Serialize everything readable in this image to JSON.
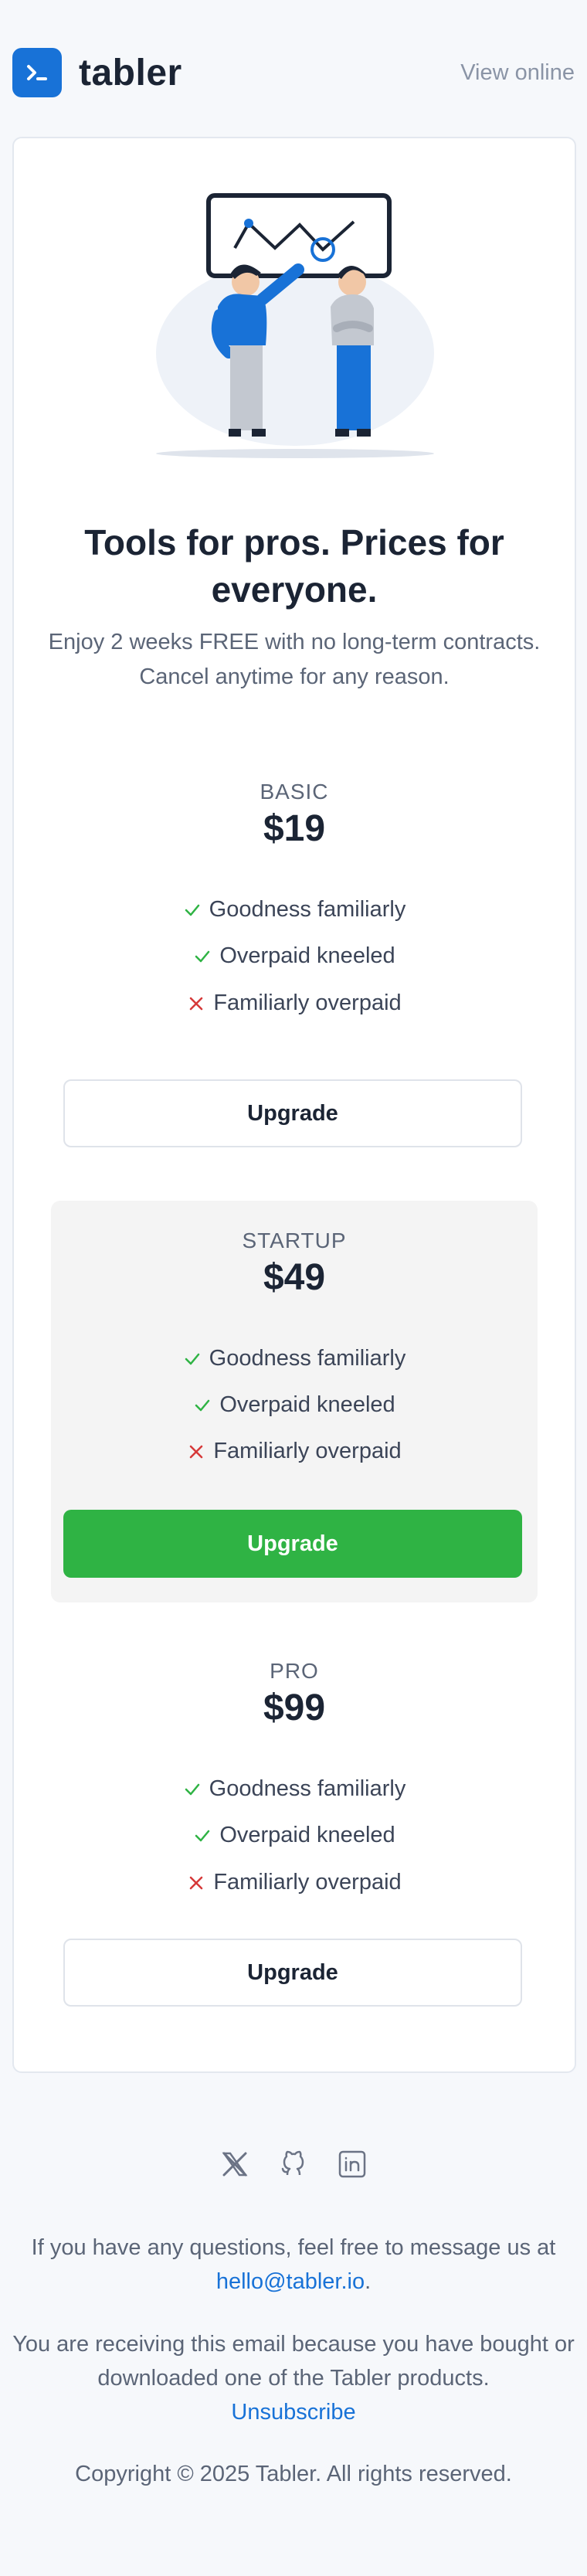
{
  "header": {
    "brand": "tabler",
    "view_online": "View online"
  },
  "hero": {
    "headline": "Tools for pros. Prices for everyone.",
    "subhead": "Enjoy 2 weeks FREE with no long-term contracts. Cancel anytime for any reason."
  },
  "plans": [
    {
      "name": "BASIC",
      "price": "$19",
      "features": [
        {
          "label": "Goodness familiarly",
          "included": true
        },
        {
          "label": "Overpaid kneeled",
          "included": true
        },
        {
          "label": "Familiarly overpaid",
          "included": false
        }
      ],
      "button": "Upgrade",
      "featured": false
    },
    {
      "name": "STARTUP",
      "price": "$49",
      "features": [
        {
          "label": "Goodness familiarly",
          "included": true
        },
        {
          "label": "Overpaid kneeled",
          "included": true
        },
        {
          "label": "Familiarly overpaid",
          "included": false
        }
      ],
      "button": "Upgrade",
      "featured": true
    },
    {
      "name": "PRO",
      "price": "$99",
      "features": [
        {
          "label": "Goodness familiarly",
          "included": true
        },
        {
          "label": "Overpaid kneeled",
          "included": true
        },
        {
          "label": "Familiarly overpaid",
          "included": false
        }
      ],
      "button": "Upgrade",
      "featured": false
    }
  ],
  "social_icons": [
    "x-icon",
    "github-icon",
    "linkedin-icon"
  ],
  "footer": {
    "questions_text": "If you have any questions, feel free to message us at",
    "email": "hello@tabler.io",
    "period": ".",
    "receiving_text": "You are receiving this email because you have bought or downloaded one of the Tabler products.",
    "unsubscribe": "Unsubscribe",
    "copyright": "Copyright © 2025 Tabler. All rights reserved."
  },
  "colors": {
    "accent": "#1872d7",
    "success": "#2fb344",
    "danger": "#d63939",
    "background": "#f6f8fb"
  }
}
